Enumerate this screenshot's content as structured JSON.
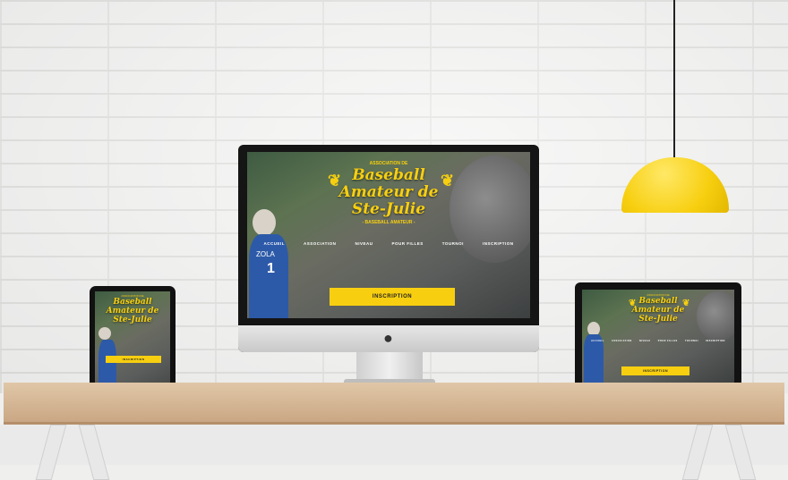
{
  "site": {
    "logo_small": "ASSOCIATION DE",
    "logo_title_line1": "Baseball",
    "logo_title_line2": "Amateur de",
    "logo_title_line3": "Ste-Julie",
    "logo_sub": "- BASEBALL AMATEUR -",
    "nav": [
      "ACCUEIL",
      "ASSOCIATION",
      "NIVEAU",
      "POUR FILLES",
      "TOURNOI",
      "INSCRIPTION"
    ],
    "cta": "INSCRIPTION",
    "jersey": "ZOLA",
    "jersey_number": "1"
  },
  "icons": {
    "apple": "apple-logo-icon",
    "laurel": "laurel-icon"
  },
  "colors": {
    "accent": "#f7cf10",
    "lamp": "#f7cf10"
  }
}
